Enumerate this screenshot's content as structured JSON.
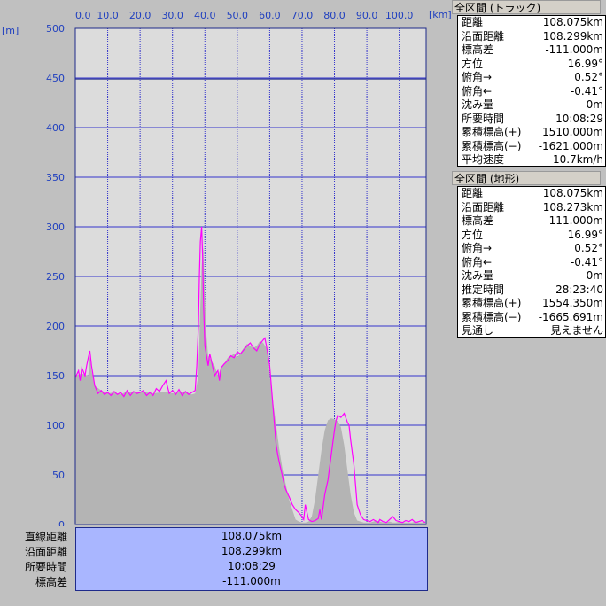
{
  "chart_data": {
    "type": "area",
    "x_unit": "[km]",
    "y_unit": "[m]",
    "xlim": [
      0,
      108.3
    ],
    "ylim": [
      0,
      500
    ],
    "x_ticks": [
      "0.0",
      "10.0",
      "20.0",
      "30.0",
      "40.0",
      "50.0",
      "60.0",
      "70.0",
      "80.0",
      "90.0",
      "100.0"
    ],
    "y_ticks": [
      "500",
      "450",
      "400",
      "350",
      "300",
      "250",
      "200",
      "150",
      "100",
      "50",
      "0"
    ],
    "terrain": {
      "x": [
        0,
        2,
        4,
        4.5,
        5,
        6,
        8,
        10,
        12,
        14,
        16,
        18,
        20,
        22,
        24,
        26,
        28,
        30,
        32,
        34,
        36,
        37,
        38,
        38.5,
        39,
        39.5,
        40,
        40.5,
        41,
        42,
        43,
        44,
        45,
        46,
        47,
        48,
        49,
        50,
        51,
        52,
        53,
        54,
        55,
        56,
        57,
        58,
        59,
        59.5,
        60,
        61,
        62,
        63,
        64,
        65,
        66,
        67,
        68,
        69,
        70,
        71,
        72,
        73,
        74,
        75,
        76,
        77,
        78,
        79,
        80,
        81,
        82,
        83,
        84,
        85,
        86,
        87,
        88,
        89,
        90,
        91,
        92,
        93,
        94,
        95,
        96,
        97,
        98,
        99,
        100,
        101,
        102,
        103,
        104,
        105,
        106,
        107,
        108
      ],
      "y": [
        150,
        152,
        150,
        170,
        155,
        140,
        135,
        132,
        133,
        131,
        134,
        133,
        134,
        133,
        132,
        133,
        134,
        132,
        133,
        134,
        131,
        132,
        150,
        210,
        260,
        280,
        230,
        190,
        170,
        165,
        160,
        150,
        158,
        162,
        168,
        170,
        172,
        168,
        173,
        178,
        182,
        180,
        178,
        180,
        185,
        183,
        178,
        170,
        150,
        125,
        100,
        75,
        55,
        40,
        25,
        15,
        5,
        3,
        2,
        2,
        3,
        8,
        25,
        50,
        75,
        95,
        105,
        107,
        106,
        104,
        98,
        80,
        55,
        30,
        12,
        4,
        3,
        2,
        2,
        2,
        3,
        4,
        3,
        2,
        2,
        3,
        2,
        2,
        3,
        2,
        2,
        2,
        2,
        3,
        2,
        2,
        3,
        2,
        2,
        3
      ]
    },
    "track": {
      "x": [
        0,
        1,
        1.5,
        2,
        3,
        3.5,
        4,
        4.5,
        5,
        5.5,
        6,
        7,
        8,
        9,
        10,
        11,
        12,
        13,
        14,
        15,
        16,
        17,
        18,
        19,
        20,
        21,
        22,
        23,
        24,
        25,
        26,
        27,
        28,
        29,
        30,
        31,
        32,
        33,
        34,
        35,
        36,
        37,
        37.5,
        38,
        38.3,
        38.6,
        39,
        39.3,
        39.6,
        40,
        40.5,
        41,
        41.5,
        42,
        43,
        44,
        44.5,
        45,
        46,
        47,
        48,
        49,
        50,
        51,
        52,
        53,
        54,
        55,
        56,
        57,
        58,
        58.5,
        59,
        59.5,
        60,
        60.5,
        61,
        61.5,
        62,
        62.5,
        63,
        63.5,
        64,
        64.5,
        65,
        66,
        67,
        68,
        69,
        70,
        70.5,
        71,
        72,
        73,
        74,
        75,
        75.5,
        76,
        77,
        78,
        79,
        80,
        80.5,
        81,
        82,
        83,
        84,
        84.5,
        85,
        86,
        86.5,
        87,
        88,
        89,
        90,
        91,
        92,
        93,
        93.5,
        94,
        95,
        96,
        97,
        98,
        99,
        100,
        101,
        102,
        103,
        104,
        105,
        106,
        107,
        107.5,
        108
      ],
      "y": [
        148,
        155,
        145,
        158,
        150,
        160,
        168,
        175,
        160,
        150,
        140,
        132,
        135,
        131,
        133,
        130,
        134,
        131,
        133,
        129,
        135,
        130,
        134,
        132,
        133,
        135,
        130,
        133,
        130,
        137,
        134,
        140,
        145,
        132,
        135,
        131,
        136,
        130,
        134,
        131,
        133,
        135,
        160,
        200,
        250,
        285,
        300,
        270,
        220,
        180,
        170,
        160,
        172,
        165,
        150,
        155,
        145,
        158,
        162,
        165,
        170,
        168,
        174,
        172,
        176,
        180,
        183,
        178,
        175,
        182,
        186,
        188,
        180,
        170,
        160,
        140,
        120,
        100,
        80,
        70,
        62,
        55,
        48,
        40,
        35,
        28,
        20,
        15,
        12,
        8,
        5,
        20,
        5,
        3,
        4,
        6,
        15,
        5,
        30,
        45,
        70,
        95,
        105,
        110,
        108,
        112,
        103,
        100,
        85,
        60,
        40,
        20,
        10,
        5,
        4,
        3,
        5,
        3,
        2,
        5,
        3,
        2,
        5,
        8,
        4,
        3,
        2,
        4,
        3,
        5,
        2,
        3,
        4,
        3,
        2,
        3,
        6,
        25
      ]
    },
    "los_line": {
      "y": 449
    }
  },
  "summary": {
    "labels": [
      "直線距離",
      "沿面距離",
      "所要時間",
      "標高差"
    ],
    "values": [
      "108.075km",
      "108.299km",
      "10:08:29",
      "-111.000m"
    ]
  },
  "track_panel": {
    "title": "全区間 (トラック)",
    "rows": [
      {
        "k": "距離",
        "v": "108.075km"
      },
      {
        "k": "沿面距離",
        "v": "108.299km"
      },
      {
        "k": "標高差",
        "v": "-111.000m"
      },
      {
        "k": "方位",
        "v": "16.99°"
      },
      {
        "k": "俯角→",
        "v": "0.52°"
      },
      {
        "k": "俯角←",
        "v": "-0.41°"
      },
      {
        "k": "沈み量",
        "v": "-0m"
      },
      {
        "k": "所要時間",
        "v": "10:08:29"
      },
      {
        "k": "累積標高(+)",
        "v": "1510.000m"
      },
      {
        "k": "累積標高(−)",
        "v": "-1621.000m"
      },
      {
        "k": "平均速度",
        "v": "10.7km/h"
      }
    ]
  },
  "terrain_panel": {
    "title": "全区間 (地形)",
    "rows": [
      {
        "k": "距離",
        "v": "108.075km"
      },
      {
        "k": "沿面距離",
        "v": "108.273km"
      },
      {
        "k": "標高差",
        "v": "-111.000m"
      },
      {
        "k": "方位",
        "v": "16.99°"
      },
      {
        "k": "俯角→",
        "v": "0.52°"
      },
      {
        "k": "俯角←",
        "v": "-0.41°"
      },
      {
        "k": "沈み量",
        "v": "-0m"
      },
      {
        "k": "推定時間",
        "v": "28:23:40"
      },
      {
        "k": "累積標高(+)",
        "v": "1554.350m"
      },
      {
        "k": "累積標高(−)",
        "v": "-1665.691m"
      },
      {
        "k": "見通し",
        "v": "見えません"
      }
    ]
  },
  "colors": {
    "plot_bg": "#dcdcdc",
    "grid": "#3333cc",
    "frame": "#1e2a8a",
    "terrain_fill": "#b4b4b4",
    "track": "#ff00ff",
    "tick_text": "#1f3fbf"
  }
}
